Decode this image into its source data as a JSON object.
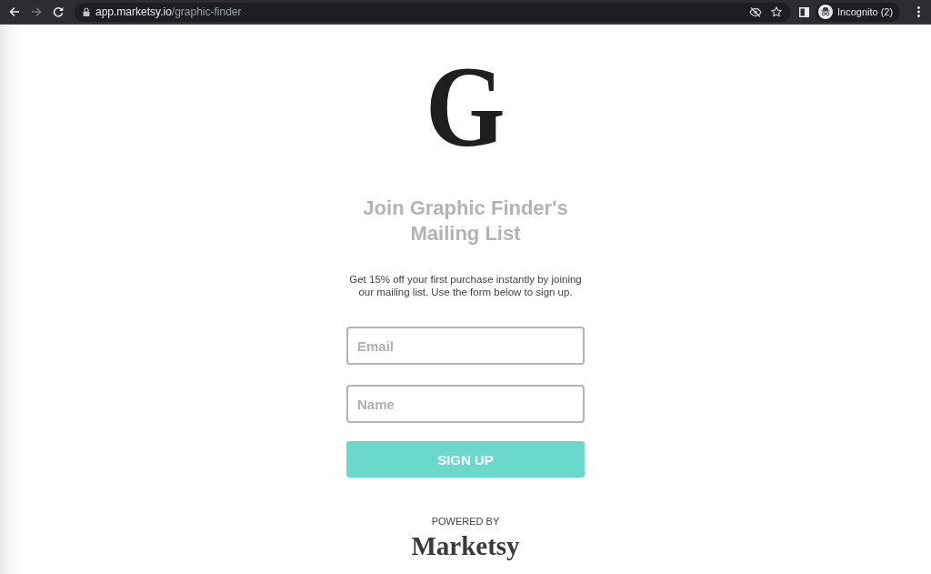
{
  "browser": {
    "nav": [
      {
        "kind": "back",
        "disabled": false
      },
      {
        "kind": "forward",
        "disabled": true
      },
      {
        "kind": "reload",
        "disabled": false
      }
    ],
    "url_host": "app.marketsy.io",
    "url_path": "/graphic-finder",
    "profile_label": "Incognito (2)"
  },
  "logo": {
    "letter": "G"
  },
  "heading": "Join Graphic Finder's Mailing List",
  "description": "Get 15% off your first purchase instantly by joining our mailing list. Use the form below to sign up.",
  "form": {
    "fields": [
      {
        "placeholder": "Email"
      },
      {
        "placeholder": "Name"
      }
    ],
    "submit": "SIGN UP"
  },
  "footer": {
    "powered_by": "POWERED BY",
    "brand": "Marketsy"
  }
}
